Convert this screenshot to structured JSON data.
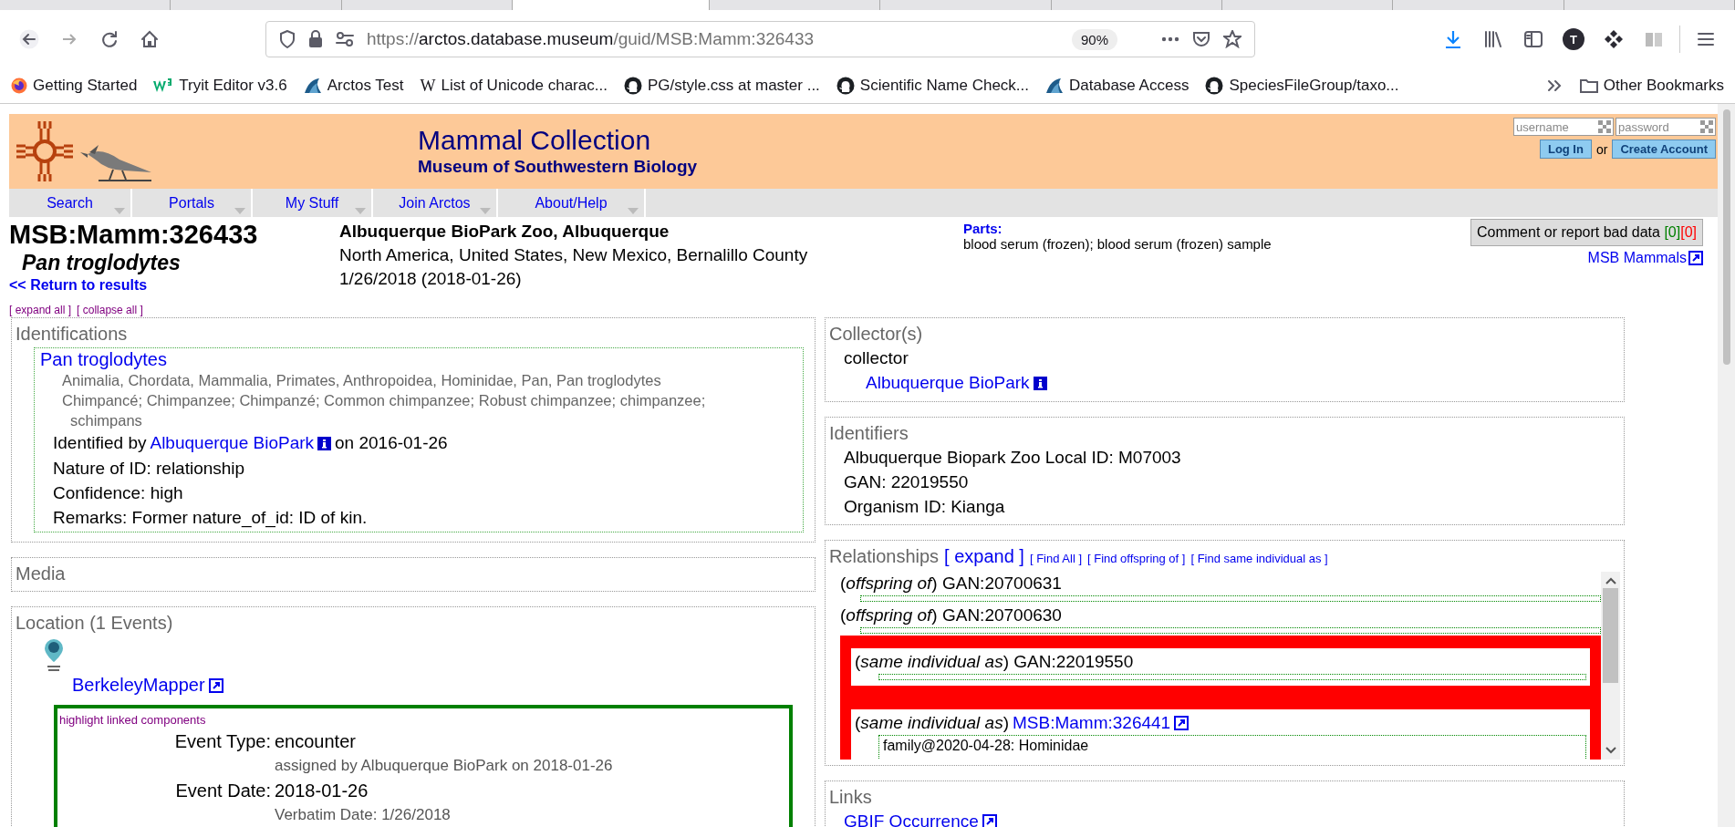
{
  "browser": {
    "url": {
      "scheme": "https://",
      "host": "arctos.database.museum",
      "path": "/guid/MSB:Mamm:326433"
    },
    "zoom": "90%",
    "profile_initial": "T",
    "bookmarks": [
      {
        "kind": "firefox",
        "label": "Getting Started"
      },
      {
        "kind": "w3",
        "label": "Tryit Editor v3.6"
      },
      {
        "kind": "fin",
        "label": "Arctos Test"
      },
      {
        "kind": "wiki",
        "glyph": "W",
        "label": "List of Unicode charac..."
      },
      {
        "kind": "github",
        "label": "PG/style.css at master ..."
      },
      {
        "kind": "github",
        "label": "Scientific Name Check..."
      },
      {
        "kind": "fin",
        "label": "Database Access"
      },
      {
        "kind": "github",
        "label": "SpeciesFileGroup/taxo..."
      }
    ],
    "other_bookmarks": "Other Bookmarks"
  },
  "header": {
    "title": "Mammal Collection",
    "subtitle": "Museum of Southwestern Biology",
    "login": {
      "username_placeholder": "username",
      "password_placeholder": "password",
      "login_button": "Log In",
      "or": "or",
      "create_button": "Create Account"
    },
    "menu": [
      "Search",
      "Portals",
      "My Stuff",
      "Join Arctos",
      "About/Help"
    ]
  },
  "record": {
    "guid": "MSB:Mamm:326433",
    "taxon": "Pan troglodytes",
    "return_link": "<< Return to results",
    "place": "Albuquerque BioPark Zoo, Albuquerque",
    "geography": "North America, United States, New Mexico, Bernalillo County",
    "date": "1/26/2018 (2018-01-26)",
    "parts_label": "Parts:",
    "parts": "blood serum (frozen); blood serum (frozen) sample",
    "comment_button": {
      "label": "Comment or report bad data",
      "counts": [
        {
          "text": "[0]",
          "color": "#008000"
        },
        {
          "text": "[0]",
          "color": "#ff0000"
        }
      ]
    },
    "collection_link": "MSB Mammals",
    "expand_all": "[ expand all ]",
    "collapse_all": "[ collapse all ]"
  },
  "left_cards": [
    {
      "kind": "identifications",
      "title": "Identifications",
      "name": "Pan troglodytes",
      "classification": "Animalia, Chordata, Mammalia, Primates, Anthropoidea, Hominidae, Pan, Pan troglodytes",
      "common_names": "Chimpancé; Chimpanzee; Chimpanzé; Common chimpanzee; Robust chimpanzee; chimpanzee; schimpans",
      "identified_by": {
        "prefix": "Identified by",
        "agent": "Albuquerque BioPark",
        "suffix": "on 2016-01-26"
      },
      "details": [
        "Nature of ID: relationship",
        "Confidence: high",
        "Remarks: Former nature_of_id: ID of kin."
      ]
    },
    {
      "kind": "media",
      "title": "Media"
    },
    {
      "kind": "location",
      "title": "Location (1 Events)",
      "mapper_link": "BerkeleyMapper",
      "highlight_link": "highlight linked components",
      "events": [
        {
          "label": "Event Type:",
          "value": "encounter",
          "note": "assigned by Albuquerque BioPark on 2018-01-26"
        },
        {
          "label": "Event Date:",
          "value": "2018-01-26",
          "note": "Verbatim Date: 1/26/2018"
        }
      ]
    }
  ],
  "right_cards": [
    {
      "kind": "collectors",
      "title": "Collector(s)",
      "role": "collector",
      "agent": "Albuquerque BioPark"
    },
    {
      "kind": "identifiers",
      "title": "Identifiers",
      "lines": [
        "Albuquerque Biopark Zoo Local ID: M07003",
        "GAN: 22019550",
        "Organism ID: Kianga"
      ]
    },
    {
      "kind": "relationships",
      "title": "Relationships",
      "expand": "[ expand ]",
      "filters": [
        "[ Find All ]",
        "[ Find offspring of ]",
        "[ Find same individual as ]"
      ],
      "items": [
        {
          "text": "(*offspring of*) GAN:20700631",
          "highlighted": false
        },
        {
          "text": "(*offspring of*) GAN:20700630",
          "highlighted": false
        },
        {
          "text": "(*same individual as*) GAN:22019550",
          "highlighted": true
        },
        {
          "text": "(*same individual as*)",
          "link": "MSB:Mamm:326441",
          "highlighted": true,
          "details": [
            "family@2020-04-28: Hominidae"
          ]
        }
      ]
    },
    {
      "kind": "links",
      "title": "Links",
      "links": [
        "GBIF Occurrence"
      ]
    }
  ]
}
